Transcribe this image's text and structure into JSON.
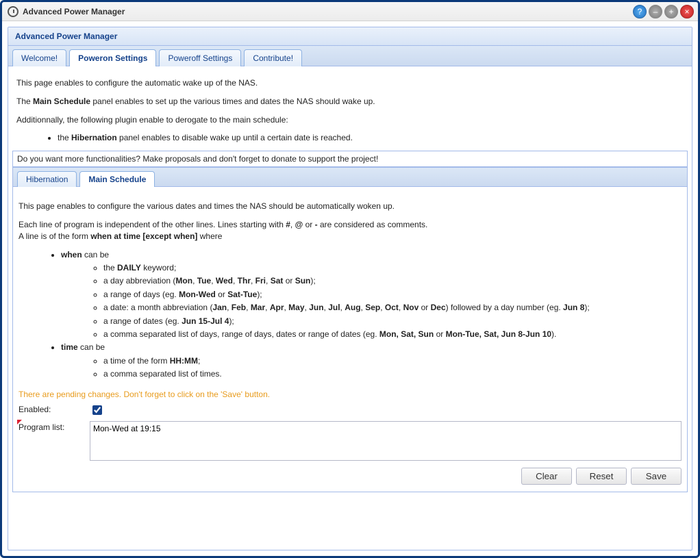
{
  "window": {
    "title": "Advanced Power Manager"
  },
  "panel": {
    "title": "Advanced Power Manager"
  },
  "tabs": {
    "welcome": "Welcome!",
    "poweron": "Poweron Settings",
    "poweroff": "Poweroff Settings",
    "contribute": "Contribute!"
  },
  "intro": {
    "p1": "This page enables to configure the automatic wake up of the NAS.",
    "p2a": "The ",
    "p2b": "Main Schedule",
    "p2c": " panel enables to set up the various times and dates the NAS should wake up.",
    "p3": "Additionnally, the following plugin enable to derogate to the main schedule:",
    "li1a": "the ",
    "li1b": "Hibernation",
    "li1c": " panel enables to disable wake up until a certain date is reached."
  },
  "donate_bar": "Do you want more functionalities? Make proposals and don't forget to donate to support the project!",
  "inner_tabs": {
    "hibernation": "Hibernation",
    "main_schedule": "Main Schedule"
  },
  "main_schedule": {
    "p1": "This page enables to configure the various dates and times the NAS should be automatically woken up.",
    "p2a": "Each line of program is independent of the other lines. Lines starting with ",
    "p2_hash": "#",
    "p2_comma1": ", ",
    "p2_at": "@",
    "p2_or": " or ",
    "p2_dash": "-",
    "p2b": " are considered as comments.",
    "p3a": "A line is of the form ",
    "p3b": "when at time [except when]",
    "p3c": " where",
    "when_label": "when",
    "when_canbe": " can be",
    "when_daily_a": "the ",
    "when_daily_b": "DAILY",
    "when_daily_c": " keyword;",
    "abbr_a": "a day abbreviation (",
    "d_mon": "Mon",
    "sep": ", ",
    "d_tue": "Tue",
    "d_wed": "Wed",
    "d_thr": "Thr",
    "d_fri": "Fri",
    "d_sat": "Sat",
    "or": " or ",
    "d_sun": "Sun",
    "abbr_b": ");",
    "range_days_a": "a range of days (eg. ",
    "range_days_b": "Mon-Wed",
    "range_days_c": "Sat-Tue",
    "range_days_end": ");",
    "date_a": "a date: a month abbreviation (",
    "m_jan": "Jan",
    "m_feb": "Feb",
    "m_mar": "Mar",
    "m_apr": "Apr",
    "m_may": "May",
    "m_jun": "Jun",
    "m_jul": "Jul",
    "m_aug": "Aug",
    "m_sep": "Sep",
    "m_oct": "Oct",
    "m_nov": "Nov",
    "m_dec": "Dec",
    "date_b": ") followed by a day number (eg. ",
    "date_c": "Jun 8",
    "date_d": ");",
    "range_dates_a": "a range of dates (eg. ",
    "range_dates_b": "Jun 15-Jul 4",
    "range_dates_c": ");",
    "comma_a": "a comma separated list of days, range of days, dates or range of dates (eg. ",
    "comma_b": "Mon, Sat, Sun",
    "comma_or": " or ",
    "comma_c": "Mon-Tue, Sat, Jun 8-Jun 10",
    "comma_d": ").",
    "time_label": "time",
    "time_canbe": " can be",
    "time_form_a": "a time of the form ",
    "time_form_b": "HH:MM",
    "time_form_c": ";",
    "time_list": "a comma separated list of times."
  },
  "pending": "There are pending changes. Don't forget to click on the 'Save' button.",
  "form": {
    "enabled_label": "Enabled:",
    "enabled_value": true,
    "programlist_label": "Program list:",
    "programlist_value": "Mon-Wed at 19:15"
  },
  "buttons": {
    "clear": "Clear",
    "reset": "Reset",
    "save": "Save"
  }
}
